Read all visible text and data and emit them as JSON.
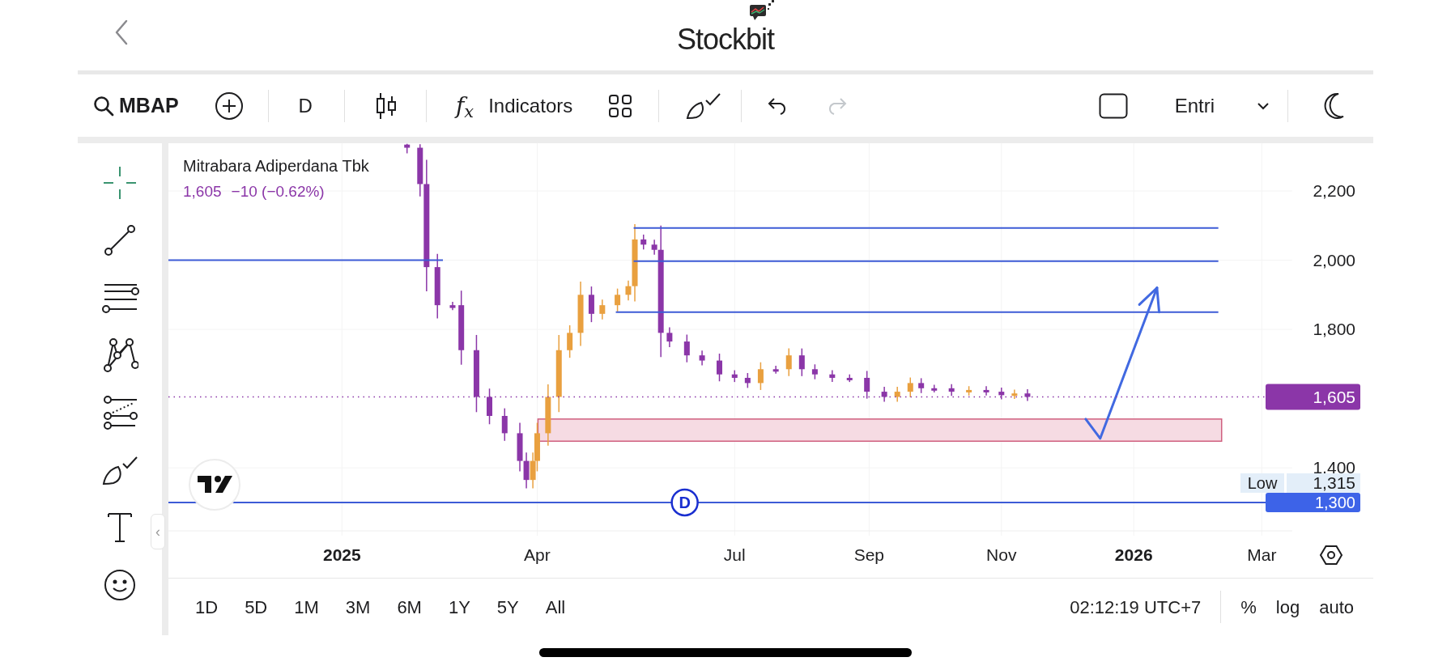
{
  "header": {
    "logo_text": "Stockbit"
  },
  "toolbar": [
    {
      "kind": "symbol",
      "label": "MBAP"
    },
    {
      "kind": "add"
    },
    {
      "kind": "interval",
      "label": "D"
    },
    {
      "kind": "chart_type"
    },
    {
      "kind": "indicators",
      "icon": "f$_{x}$",
      "label": "Indicators"
    },
    {
      "kind": "layout"
    },
    {
      "kind": "drawing"
    },
    {
      "kind": "undo",
      "disabled": false
    },
    {
      "kind": "redo",
      "disabled": true
    },
    {
      "kind": "fullscreen"
    },
    {
      "kind": "order_type",
      "label": "Entri"
    },
    {
      "kind": "theme"
    }
  ],
  "drawing_tools": [
    {
      "kind": "crosshair",
      "selected": true
    },
    {
      "kind": "trend_line",
      "selected": false
    },
    {
      "kind": "parallel_lines",
      "selected": false
    },
    {
      "kind": "pattern",
      "selected": false
    },
    {
      "kind": "forecast",
      "selected": false
    },
    {
      "kind": "brush",
      "selected": false
    },
    {
      "kind": "text",
      "selected": false
    },
    {
      "kind": "emoji",
      "selected": false
    }
  ],
  "collapse_tab": "‹",
  "chart": {
    "name": "Mitrabara Adiperdana Tbk",
    "price": "1,605",
    "change": "−10 (−0.62%)",
    "low_caption": "Low",
    "chart_data": {
      "type": "candlestick",
      "grid": true,
      "xlim": [
        "2024-10-13",
        "2026-03-15"
      ],
      "ylim": [
        1218,
        2338
      ],
      "x": [
        "2025-01-31",
        "2025-02-06",
        "2025-02-09",
        "2025-02-14",
        "2025-02-21",
        "2025-02-25",
        "2025-03-04",
        "2025-03-10",
        "2025-03-17",
        "2025-03-24",
        "2025-03-27",
        "2025-03-30",
        "2025-04-01",
        "2025-04-06",
        "2025-04-11",
        "2025-04-16",
        "2025-04-21",
        "2025-04-26",
        "2025-05-01",
        "2025-05-08",
        "2025-05-13",
        "2025-05-16",
        "2025-05-20",
        "2025-05-25",
        "2025-05-28",
        "2025-06-01",
        "2025-06-09",
        "2025-06-16",
        "2025-06-24",
        "2025-07-01",
        "2025-07-07",
        "2025-07-13",
        "2025-07-20",
        "2025-07-26",
        "2025-08-01",
        "2025-08-07",
        "2025-08-15",
        "2025-08-23",
        "2025-08-31",
        "2025-09-08",
        "2025-09-14",
        "2025-09-20",
        "2025-09-25",
        "2025-10-01",
        "2025-10-09",
        "2025-10-17",
        "2025-10-25",
        "2025-11-01",
        "2025-11-07",
        "2025-11-13"
      ],
      "ohlc": [
        [
          2334,
          2336,
          2309,
          2325
        ],
        [
          2325,
          2335,
          2184,
          2220
        ],
        [
          2220,
          2290,
          1910,
          1980
        ],
        [
          1980,
          2018,
          1832,
          1870
        ],
        [
          1870,
          1880,
          1856,
          1862
        ],
        [
          1870,
          1912,
          1698,
          1740
        ],
        [
          1740,
          1784,
          1561,
          1605
        ],
        [
          1605,
          1629,
          1526,
          1550
        ],
        [
          1550,
          1572,
          1478,
          1500
        ],
        [
          1500,
          1530,
          1390,
          1420
        ],
        [
          1420,
          1444,
          1341,
          1365
        ],
        [
          1365,
          1444,
          1341,
          1420
        ],
        [
          1420,
          1530,
          1390,
          1500
        ],
        [
          1500,
          1641,
          1464,
          1605
        ],
        [
          1605,
          1784,
          1561,
          1740
        ],
        [
          1740,
          1812,
          1718,
          1790
        ],
        [
          1790,
          1938,
          1752,
          1900
        ],
        [
          1900,
          1924,
          1821,
          1845
        ],
        [
          1845,
          1886,
          1829,
          1870
        ],
        [
          1870,
          1918,
          1852,
          1900
        ],
        [
          1900,
          1941,
          1884,
          1925
        ],
        [
          1925,
          2104,
          1881,
          2060
        ],
        [
          2060,
          2074,
          2031,
          2045
        ],
        [
          2045,
          2059,
          2016,
          2030
        ],
        [
          2030,
          2100,
          1720,
          1790
        ],
        [
          1790,
          1806,
          1749,
          1765
        ],
        [
          1765,
          1785,
          1705,
          1725
        ],
        [
          1725,
          1739,
          1696,
          1710
        ],
        [
          1710,
          1730,
          1650,
          1670
        ],
        [
          1670,
          1682,
          1648,
          1660
        ],
        [
          1660,
          1674,
          1631,
          1645
        ],
        [
          1645,
          1705,
          1625,
          1685
        ],
        [
          1685,
          1695,
          1672,
          1680
        ],
        [
          1685,
          1745,
          1665,
          1725
        ],
        [
          1725,
          1745,
          1665,
          1685
        ],
        [
          1685,
          1699,
          1656,
          1670
        ],
        [
          1670,
          1682,
          1648,
          1660
        ],
        [
          1660,
          1670,
          1648,
          1655
        ],
        [
          1660,
          1680,
          1600,
          1620
        ],
        [
          1620,
          1634,
          1591,
          1605
        ],
        [
          1605,
          1634,
          1591,
          1620
        ],
        [
          1620,
          1661,
          1604,
          1645
        ],
        [
          1645,
          1659,
          1616,
          1630
        ],
        [
          1630,
          1640,
          1618,
          1626
        ],
        [
          1630,
          1642,
          1608,
          1620
        ],
        [
          1620,
          1636,
          1609,
          1625
        ],
        [
          1625,
          1636,
          1609,
          1620
        ],
        [
          1620,
          1632,
          1598,
          1610
        ],
        [
          1610,
          1626,
          1599,
          1615
        ],
        [
          1615,
          1627,
          1593,
          1605
        ]
      ],
      "xticks": [
        {
          "value": "2025-01-01",
          "label": "2025"
        },
        {
          "value": "2025-04-01",
          "label": "Apr"
        },
        {
          "value": "2025-07-01",
          "label": "Jul"
        },
        {
          "value": "2025-09-01",
          "label": "Sep"
        },
        {
          "value": "2025-11-01",
          "label": "Nov"
        },
        {
          "value": "2026-01-01",
          "label": "2026"
        },
        {
          "value": "2026-03-01",
          "label": "Mar"
        }
      ],
      "yticks": [
        {
          "value": 1400,
          "label": "1,400"
        },
        {
          "value": 1800,
          "label": "1,800"
        },
        {
          "value": 2000,
          "label": "2,000"
        },
        {
          "value": 2200,
          "label": "2,200"
        }
      ],
      "ref_lines": [
        {
          "axis": "y",
          "value": 2000
        },
        {
          "axis": "y",
          "value": 2093
        },
        {
          "axis": "y",
          "value": 1997
        },
        {
          "axis": "y",
          "value": 1850
        },
        {
          "axis": "y",
          "value": 1300
        },
        {
          "axis": "y",
          "value": 1605,
          "label": "1,605"
        }
      ],
      "bands": [
        {
          "axis": "y",
          "from": 1477,
          "to": 1541
        }
      ],
      "annotations": [
        {
          "x": "2025-06-08",
          "y": 1300,
          "text": "D"
        }
      ]
    },
    "low_value": "1,315",
    "line_label": "1,300"
  },
  "ranges": [
    "1D",
    "5D",
    "1M",
    "3M",
    "6M",
    "1Y",
    "5Y",
    "All"
  ],
  "clock": "02:12:19 UTC+7",
  "scale_buttons": [
    "%",
    "log",
    "auto"
  ]
}
